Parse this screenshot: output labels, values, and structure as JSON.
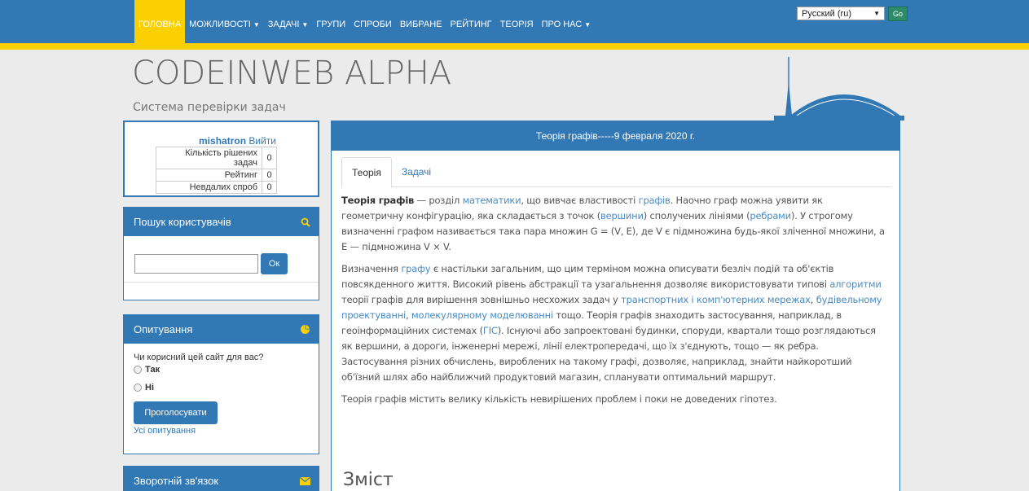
{
  "nav": {
    "items": [
      {
        "label": "ГОЛОВНА",
        "caret": false,
        "active": true
      },
      {
        "label": "МОЖЛИВОСТІ",
        "caret": true,
        "active": false
      },
      {
        "label": "ЗАДАЧІ",
        "caret": true,
        "active": false
      },
      {
        "label": "ГРУПИ",
        "caret": false,
        "active": false
      },
      {
        "label": "СПРОБИ",
        "caret": false,
        "active": false
      },
      {
        "label": "ВИБРАНЕ",
        "caret": false,
        "active": false
      },
      {
        "label": "РЕЙТИНГ",
        "caret": false,
        "active": false
      },
      {
        "label": "ТЕОРІЯ",
        "caret": false,
        "active": false
      },
      {
        "label": "ПРО НАС",
        "caret": true,
        "active": false
      }
    ],
    "language": "Русский (ru)",
    "go_label": "Go"
  },
  "header": {
    "title": "CODEINWEB ALPHA",
    "subtitle": "Система перевірки задач"
  },
  "user": {
    "name": "mishatron",
    "logout": "Вийти",
    "stats": [
      {
        "label": "Кількість рішених задач",
        "value": "0"
      },
      {
        "label": "Рейтинг",
        "value": "0"
      },
      {
        "label": "Невдалих спроб",
        "value": "0"
      }
    ]
  },
  "search": {
    "title": "Пошук користувачів",
    "button": "Ок",
    "value": ""
  },
  "poll": {
    "title": "Опитування",
    "question": "Чи корисний цей сайт для вас?",
    "options": [
      "Так",
      "Ні"
    ],
    "vote_button": "Проголосувати",
    "all_polls": "Усі опитування"
  },
  "feedback": {
    "title": "Зворотній зв'язок"
  },
  "main": {
    "heading": "Теорія графів-----9 февраля 2020 г.",
    "tabs": [
      "Теорія",
      "Задачі"
    ],
    "toc_title": "Зміст"
  },
  "colors": {
    "primary": "#3278b5",
    "accent": "#fcd000",
    "link": "#4a8bc4"
  }
}
